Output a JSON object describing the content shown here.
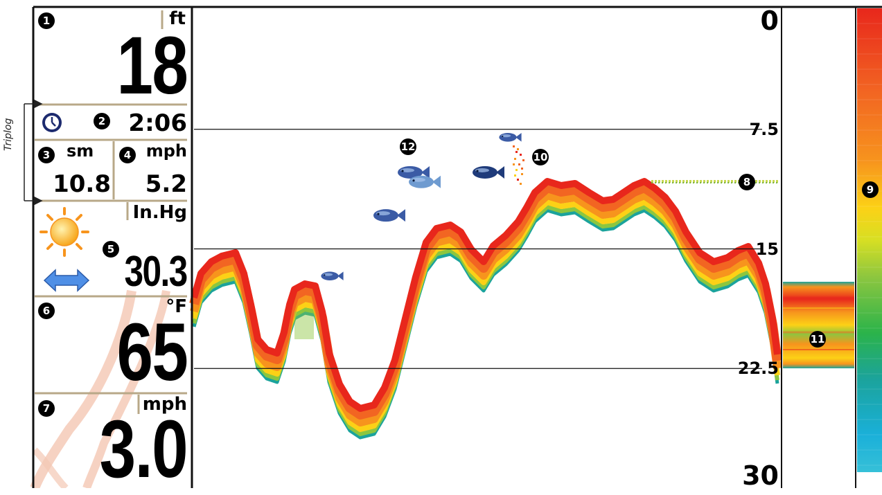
{
  "colors": {
    "frame": "#111111",
    "divider": "#b8a888",
    "sonar_red": "#e8271c",
    "sonar_orange": "#f7941d",
    "sonar_yellow": "#fcd116",
    "sonar_green": "#8cc63f",
    "sonar_teal": "#1ba39c",
    "fish_blue": "#3b5ba5",
    "sun": "#fbb03b",
    "arrow_blue": "#3f7fd8"
  },
  "sidebar": {
    "depth": {
      "unit": "ft",
      "value": "18",
      "callout": "1"
    },
    "clock": {
      "icon": "clock-icon",
      "value": "2:06",
      "callout": "2"
    },
    "distance": {
      "unit": "sm",
      "value": "10.8",
      "callout": "3"
    },
    "speed_trip": {
      "unit": "mph",
      "value": "5.2",
      "callout": "4"
    },
    "barometer": {
      "unit": "In.Hg",
      "value": "30.3",
      "callout": "5",
      "weather_icon": "sun-icon",
      "trend_icon": "steady-arrow-icon"
    },
    "temperature": {
      "unit": "°F",
      "value": "65",
      "callout": "6"
    },
    "speed": {
      "unit": "mph",
      "value": "3.0",
      "callout": "7"
    },
    "triplog_label": "Triplog"
  },
  "sonar": {
    "scale": {
      "min": 0,
      "max": 30,
      "labels": [
        "0",
        "7.5",
        "15",
        "22.5",
        "30"
      ]
    },
    "callouts": {
      "surface_clutter": "8",
      "color_bar": "9",
      "fish_marks_raw": "10",
      "zoom_flasher": "11",
      "fish_id": "12"
    },
    "fish": [
      {
        "icon": "fish-icon-large",
        "depth": 10.2
      },
      {
        "icon": "fish-icon-large",
        "depth": 10.8
      },
      {
        "icon": "fish-icon-large",
        "depth": 10.2
      },
      {
        "icon": "fish-icon-small",
        "depth": 8.0
      },
      {
        "icon": "fish-icon-large",
        "depth": 12.9
      },
      {
        "icon": "fish-icon-small",
        "depth": 16.7
      }
    ]
  }
}
